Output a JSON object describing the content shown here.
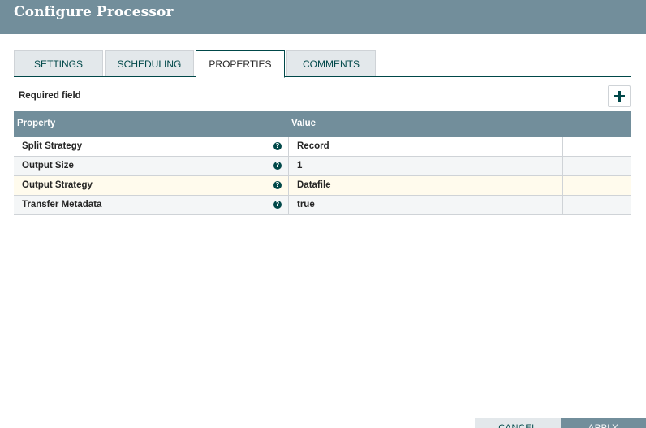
{
  "dialog": {
    "title": "Configure Processor"
  },
  "tabs": [
    {
      "label": "SETTINGS"
    },
    {
      "label": "SCHEDULING"
    },
    {
      "label": "PROPERTIES"
    },
    {
      "label": "COMMENTS"
    }
  ],
  "active_tab": "PROPERTIES",
  "properties": {
    "required_label": "Required field",
    "add_icon": "plus-icon",
    "columns": {
      "property": "Property",
      "value": "Value"
    },
    "rows": [
      {
        "name": "Split Strategy",
        "value": "Record"
      },
      {
        "name": "Output Size",
        "value": "1"
      },
      {
        "name": "Output Strategy",
        "value": "Datafile"
      },
      {
        "name": "Transfer Metadata",
        "value": "true"
      }
    ],
    "help_icon": "question-circle-icon",
    "help_glyph": "?"
  },
  "footer": {
    "cancel_label": "CANCEL",
    "apply_label": "APPLY"
  },
  "colors": {
    "header_bg": "#728e9b",
    "accent": "#004849",
    "selected_row": "#fffbed",
    "tab_inactive": "#e3e8eb"
  }
}
